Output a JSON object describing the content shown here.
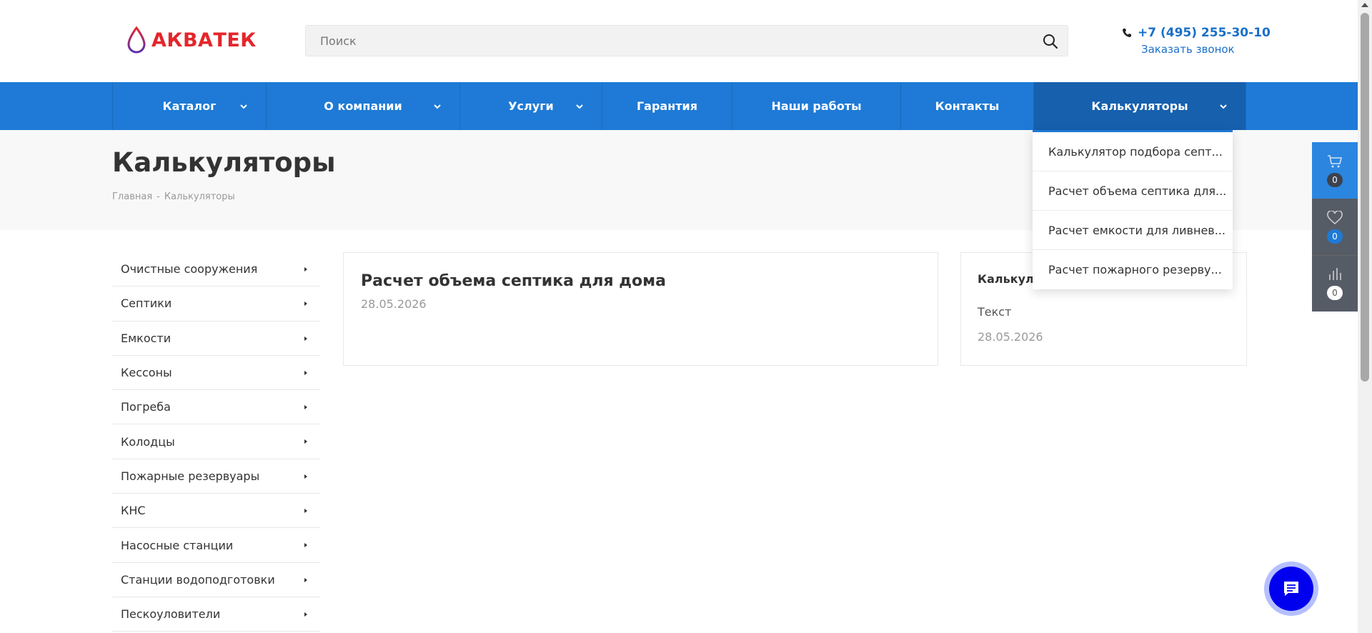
{
  "header": {
    "logo_text": "АКВАТЕК",
    "search_placeholder": "Поиск",
    "phone": "+7 (495) 255-30-10",
    "callback": "Заказать звонок"
  },
  "nav": {
    "items": [
      {
        "label": "Каталог"
      },
      {
        "label": "О компании"
      },
      {
        "label": "Услуги"
      },
      {
        "label": "Гарантия"
      },
      {
        "label": "Наши работы"
      },
      {
        "label": "Контакты"
      },
      {
        "label": "Калькуляторы"
      }
    ]
  },
  "page": {
    "title": "Калькуляторы",
    "breadcrumb": [
      "Главная",
      "-",
      "Калькуляторы"
    ]
  },
  "sidebar": {
    "items": [
      "Очистные сооружения",
      "Септики",
      "Емкости",
      "Кессоны",
      "Погреба",
      "Колодцы",
      "Пожарные резервуары",
      "КНС",
      "Насосные станции",
      "Станции водоподготовки",
      "Пескоуловители"
    ]
  },
  "main_card": {
    "title": "Расчет объема септика для дома",
    "date": "28.05.2026"
  },
  "side_card": {
    "title": "Калькуля",
    "text": "Текст",
    "date": "28.05.2026"
  },
  "dropdown": {
    "items": [
      "Калькулятор подбора септ...",
      "Расчет объема септика для...",
      "Расчет емкости для ливнев...",
      "Расчет пожарного резерву..."
    ]
  },
  "right_panel": {
    "cart_count": "0",
    "favorites_count": "0",
    "compare_count": "0"
  },
  "colors": {
    "nav_blue": "#1e7ad6",
    "logo_red": "#e4262b",
    "link_blue": "#1a6fc9"
  }
}
